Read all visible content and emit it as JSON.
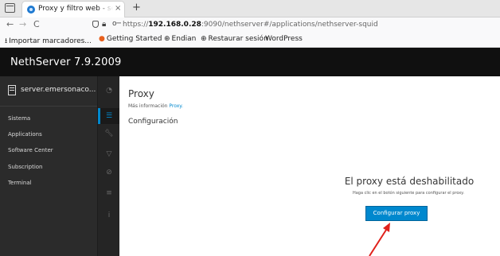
{
  "browser": {
    "tab": {
      "title": "Proxy y filtro web - serve",
      "close_glyph": "×"
    },
    "new_tab_glyph": "+",
    "nav": {
      "back_glyph": "←",
      "forward_glyph": "→",
      "reload_glyph": "C"
    },
    "url": {
      "prefix": "https://",
      "host": "192.168.0.28",
      "rest": ":9090/nethserver#/applications/nethserver-squid"
    },
    "bookmarks": [
      {
        "icon": "import-icon",
        "label": "Importar marcadores..."
      },
      {
        "icon": "firefox-icon",
        "label": "Getting Started"
      },
      {
        "icon": "globe-icon",
        "label": "Endian"
      },
      {
        "icon": "globe-icon",
        "label": "Restaurar sesión"
      },
      {
        "icon": "",
        "label": "WordPress"
      }
    ]
  },
  "app": {
    "brand": "NethServer 7.9.2009"
  },
  "sidebar": {
    "host": "server.emersonaco...",
    "items": [
      {
        "label": "Sistema"
      },
      {
        "label": "Applications"
      },
      {
        "label": "Software Center"
      },
      {
        "label": "Subscription"
      },
      {
        "label": "Terminal"
      }
    ],
    "icons": [
      "dashboard-icon",
      "list-icon",
      "wrench-icon",
      "filter-icon",
      "block-icon",
      "bars-icon",
      "info-icon"
    ],
    "accent": "#0088ce"
  },
  "main": {
    "title": "Proxy",
    "more_info_prefix": "Más información",
    "more_info_link": "Proxy.",
    "section": "Configuración",
    "empty_title": "El proxy está deshabilitado",
    "empty_msg": "Haga clic en el botón siguiente para configurar el proxy.",
    "button": "Configurar proxy",
    "annotation_color": "#e0211b"
  }
}
